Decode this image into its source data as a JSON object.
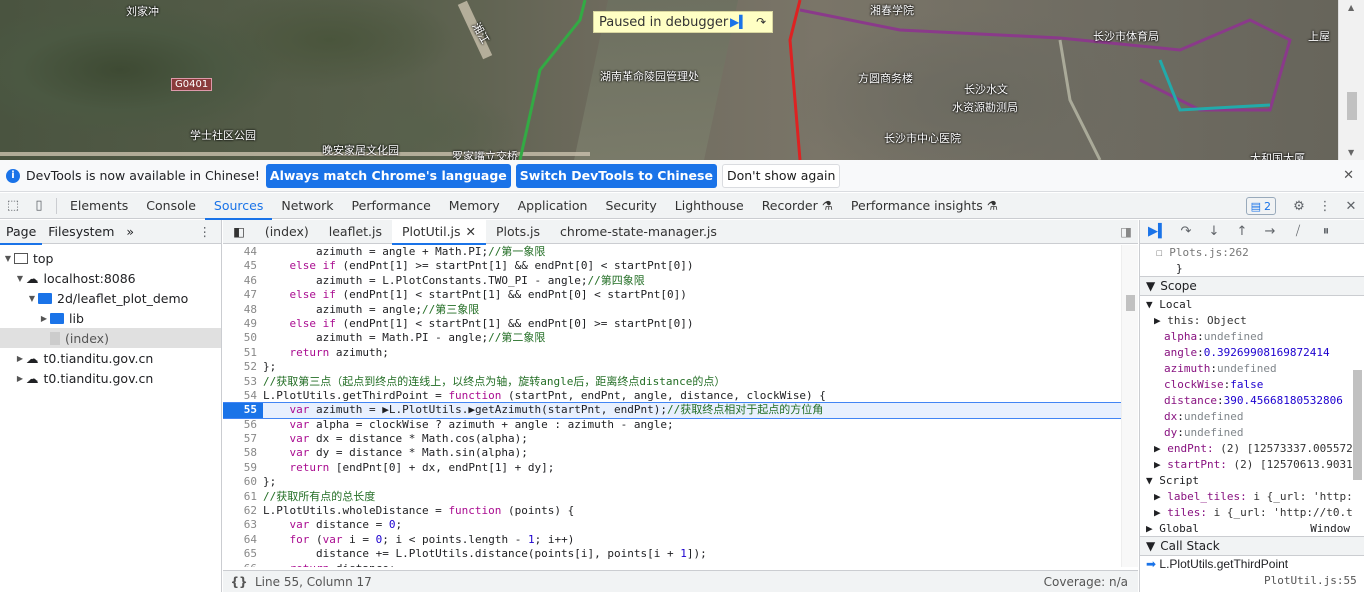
{
  "map": {
    "labels": [
      "刘家冲",
      "G0401",
      "学士社区公园",
      "晚安家居文化园",
      "湖南革命陵园管理处",
      "湘春学院",
      "方圆商务楼",
      "长沙水文",
      "水资源勘测局",
      "长沙市中心医院",
      "长沙市体育局",
      "罗家嘴立交桥",
      "上屋",
      "湘江",
      "大和国大厦"
    ],
    "paused_label": "Paused in debugger"
  },
  "infobar": {
    "message": "DevTools is now available in Chinese!",
    "btn_match": "Always match Chrome's language",
    "btn_switch": "Switch DevTools to Chinese",
    "btn_dont": "Don't show again"
  },
  "panels": [
    "Elements",
    "Console",
    "Sources",
    "Network",
    "Performance",
    "Memory",
    "Application",
    "Security",
    "Lighthouse",
    "Recorder",
    "Performance insights"
  ],
  "active_panel": "Sources",
  "issues_count": "2",
  "navigator": {
    "tabs": [
      "Page",
      "Filesystem"
    ],
    "tree": [
      {
        "label": "top",
        "level": 0,
        "icon": "frame"
      },
      {
        "label": "localhost:8086",
        "level": 1,
        "icon": "cloud"
      },
      {
        "label": "2d/leaflet_plot_demo",
        "level": 2,
        "icon": "folder"
      },
      {
        "label": "lib",
        "level": 3,
        "icon": "folder"
      },
      {
        "label": "(index)",
        "level": 3,
        "icon": "file"
      },
      {
        "label": "t0.tianditu.gov.cn",
        "level": 1,
        "icon": "cloud"
      },
      {
        "label": "t0.tianditu.gov.cn",
        "level": 1,
        "icon": "cloud"
      }
    ]
  },
  "editor": {
    "tabs": [
      "(index)",
      "leaflet.js",
      "PlotUtil.js",
      "Plots.js",
      "chrome-state-manager.js"
    ],
    "active_tab": "PlotUtil.js",
    "breakpoint_line": 55,
    "lines": [
      {
        "n": 44,
        "segs": [
          [
            "tx",
            "        azimuth = angle + Math.PI;"
          ],
          [
            "cm",
            "//第一象限"
          ]
        ]
      },
      {
        "n": 45,
        "segs": [
          [
            "tx",
            "    "
          ],
          [
            "kw",
            "else if"
          ],
          [
            "tx",
            " (endPnt[1] >= startPnt[1] && endPnt[0] < startPnt[0])"
          ]
        ]
      },
      {
        "n": 46,
        "segs": [
          [
            "tx",
            "        azimuth = L.PlotConstants.TWO_PI - angle;"
          ],
          [
            "cm",
            "//第四象限"
          ]
        ]
      },
      {
        "n": 47,
        "segs": [
          [
            "tx",
            "    "
          ],
          [
            "kw",
            "else if"
          ],
          [
            "tx",
            " (endPnt[1] < startPnt[1] && endPnt[0] < startPnt[0])"
          ]
        ]
      },
      {
        "n": 48,
        "segs": [
          [
            "tx",
            "        azimuth = angle;"
          ],
          [
            "cm",
            "//第三象限"
          ]
        ]
      },
      {
        "n": 49,
        "segs": [
          [
            "tx",
            "    "
          ],
          [
            "kw",
            "else if"
          ],
          [
            "tx",
            " (endPnt[1] < startPnt[1] && endPnt[0] >= startPnt[0])"
          ]
        ]
      },
      {
        "n": 50,
        "segs": [
          [
            "tx",
            "        azimuth = Math.PI - angle;"
          ],
          [
            "cm",
            "//第二象限"
          ]
        ]
      },
      {
        "n": 51,
        "segs": [
          [
            "tx",
            "    "
          ],
          [
            "kw",
            "return"
          ],
          [
            "tx",
            " azimuth;"
          ]
        ]
      },
      {
        "n": 52,
        "segs": [
          [
            "tx",
            "};"
          ]
        ]
      },
      {
        "n": 53,
        "segs": [
          [
            "cm",
            "//获取第三点（起点到终点的连线上，以终点为轴，旋转angle后，距离终点distance的点）"
          ]
        ]
      },
      {
        "n": 54,
        "segs": [
          [
            "tx",
            "L.PlotUtils.getThirdPoint = "
          ],
          [
            "kw",
            "function"
          ],
          [
            "tx",
            " (startPnt, endPnt, angle, distance, clockWise) {"
          ]
        ]
      },
      {
        "n": 55,
        "segs": [
          [
            "tx",
            "    "
          ],
          [
            "kw",
            "var"
          ],
          [
            "tx",
            " azimuth = ▶L.PlotUtils.▶getAzimuth(startPnt, endPnt);"
          ],
          [
            "cm",
            "//获取终点相对于起点的方位角"
          ]
        ]
      },
      {
        "n": 56,
        "segs": [
          [
            "tx",
            "    "
          ],
          [
            "kw",
            "var"
          ],
          [
            "tx",
            " alpha = clockWise ? azimuth + angle : azimuth - angle;"
          ]
        ]
      },
      {
        "n": 57,
        "segs": [
          [
            "tx",
            "    "
          ],
          [
            "kw",
            "var"
          ],
          [
            "tx",
            " dx = distance * Math.cos(alpha);"
          ]
        ]
      },
      {
        "n": 58,
        "segs": [
          [
            "tx",
            "    "
          ],
          [
            "kw",
            "var"
          ],
          [
            "tx",
            " dy = distance * Math.sin(alpha);"
          ]
        ]
      },
      {
        "n": 59,
        "segs": [
          [
            "tx",
            "    "
          ],
          [
            "kw",
            "return"
          ],
          [
            "tx",
            " [endPnt[0] + dx, endPnt[1] + dy];"
          ]
        ]
      },
      {
        "n": 60,
        "segs": [
          [
            "tx",
            "};"
          ]
        ]
      },
      {
        "n": 61,
        "segs": [
          [
            "cm",
            "//获取所有点的总长度"
          ]
        ]
      },
      {
        "n": 62,
        "segs": [
          [
            "tx",
            "L.PlotUtils.wholeDistance = "
          ],
          [
            "kw",
            "function"
          ],
          [
            "tx",
            " (points) {"
          ]
        ]
      },
      {
        "n": 63,
        "segs": [
          [
            "tx",
            "    "
          ],
          [
            "kw",
            "var"
          ],
          [
            "tx",
            " distance = "
          ],
          [
            "nm",
            "0"
          ],
          [
            "tx",
            ";"
          ]
        ]
      },
      {
        "n": 64,
        "segs": [
          [
            "tx",
            "    "
          ],
          [
            "kw",
            "for"
          ],
          [
            "tx",
            " ("
          ],
          [
            "kw",
            "var"
          ],
          [
            "tx",
            " i = "
          ],
          [
            "nm",
            "0"
          ],
          [
            "tx",
            "; i < points.length - "
          ],
          [
            "nm",
            "1"
          ],
          [
            "tx",
            "; i++)"
          ]
        ]
      },
      {
        "n": 65,
        "segs": [
          [
            "tx",
            "        distance += L.PlotUtils.distance(points[i], points[i + "
          ],
          [
            "nm",
            "1"
          ],
          [
            "tx",
            "]);"
          ]
        ]
      },
      {
        "n": 66,
        "segs": [
          [
            "tx",
            "    "
          ],
          [
            "kw",
            "return"
          ],
          [
            "tx",
            " distance;"
          ]
        ]
      }
    ],
    "status_position": "Line 55, Column 17",
    "status_coverage": "Coverage: n/a"
  },
  "debugger": {
    "prev_frame": "Plots.js:262",
    "prev_brace": "}",
    "scope_title": "Scope",
    "local_title": "Local",
    "this_val": "this: Object",
    "vars": [
      {
        "name": "alpha",
        "value": "undefined",
        "kind": "obj"
      },
      {
        "name": "angle",
        "value": "0.39269908169872414",
        "kind": "num"
      },
      {
        "name": "azimuth",
        "value": "undefined",
        "kind": "obj"
      },
      {
        "name": "clockWise",
        "value": "false",
        "kind": "num"
      },
      {
        "name": "distance",
        "value": "390.45668180532806",
        "kind": "num"
      },
      {
        "name": "dx",
        "value": "undefined",
        "kind": "obj"
      },
      {
        "name": "dy",
        "value": "undefined",
        "kind": "obj"
      }
    ],
    "endPnt": "(2) [12573337.005572",
    "startPnt": "(2) [12570613.9031",
    "script_title": "Script",
    "label_tiles": "i {_url: 'http:",
    "tiles": "i {_url: 'http://t0.t",
    "global_title": "Global",
    "global_val": "Window",
    "callstack_title": "Call Stack",
    "frame_name": "L.PlotUtils.getThirdPoint",
    "frame_loc": "PlotUtil.js:55"
  }
}
